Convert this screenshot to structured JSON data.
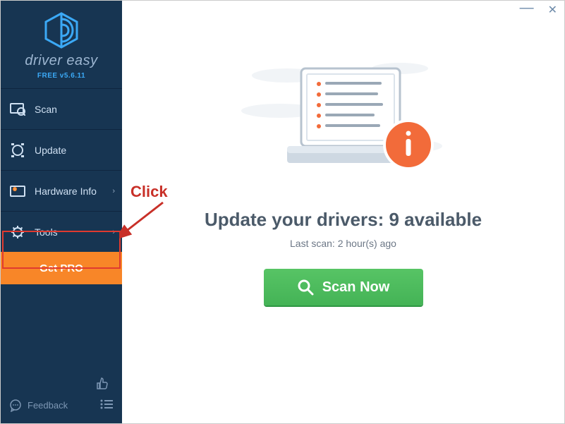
{
  "app": {
    "brand": "driver easy",
    "version": "FREE v5.6.11"
  },
  "sidebar": {
    "items": [
      {
        "label": "Scan",
        "icon": "scan-icon",
        "chevron": false
      },
      {
        "label": "Update",
        "icon": "update-icon",
        "chevron": false
      },
      {
        "label": "Hardware Info",
        "icon": "hardware-icon",
        "chevron": true
      },
      {
        "label": "Tools",
        "icon": "tools-icon",
        "chevron": true
      }
    ],
    "get_pro_label": "Get PRO",
    "feedback_label": "Feedback"
  },
  "main": {
    "headline_prefix": "Update your drivers: ",
    "headline_count": "9",
    "headline_suffix": " available",
    "last_scan": "Last scan: 2 hour(s) ago",
    "scan_button": "Scan Now"
  },
  "annotation": {
    "label": "Click"
  }
}
